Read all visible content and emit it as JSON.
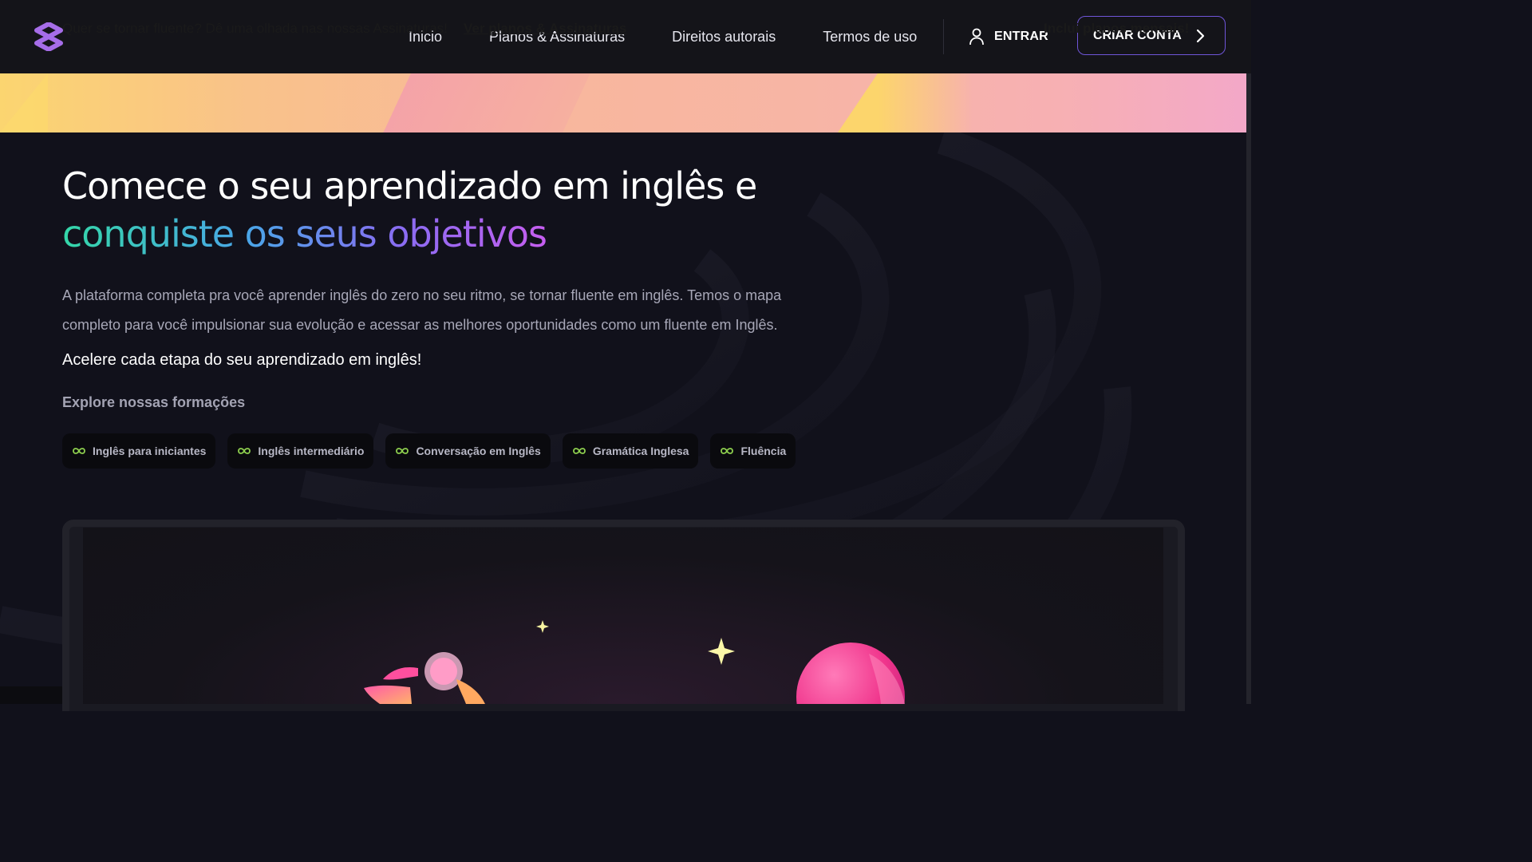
{
  "nav": {
    "links": [
      "Inicio",
      "Planos & Assinaturas",
      "Direitos autorais",
      "Termos de uso"
    ],
    "login_label": "ENTRAR",
    "cta_label": "CRIAR CONTA"
  },
  "banner": {
    "text": "Quer se tornar fluente? Dê uma olhada nas nossas Assinaturas!",
    "link": "Ver planos & Assinaturas",
    "right_text": "Inclui planos mensais!"
  },
  "hero": {
    "title_line1": "Comece o seu aprendizado em inglês e",
    "title_line2": "conquiste os seus objetivos",
    "description": "A plataforma completa pra você aprender inglês do zero no seu ritmo, se tornar fluente em inglês. Temos o mapa completo para você impulsionar sua evolução e acessar as melhores oportunidades como um fluente em Inglês.",
    "subtitle": "Acelere cada etapa do seu aprendizado em inglês!",
    "explore_label": "Explore nossas formações",
    "chips": [
      "Inglês para iniciantes",
      "Inglês intermediário",
      "Conversação em Inglês",
      "Gramática Inglesa",
      "Fluência"
    ]
  },
  "colors": {
    "background": "#11111b",
    "nav_bg": "#141419",
    "accent": "#6f55d8",
    "chip_icon": "#8fd14f"
  },
  "icons": [
    "logo-icon",
    "user-icon",
    "chevron-right-icon",
    "infinity-icon",
    "sparkle-icon"
  ]
}
